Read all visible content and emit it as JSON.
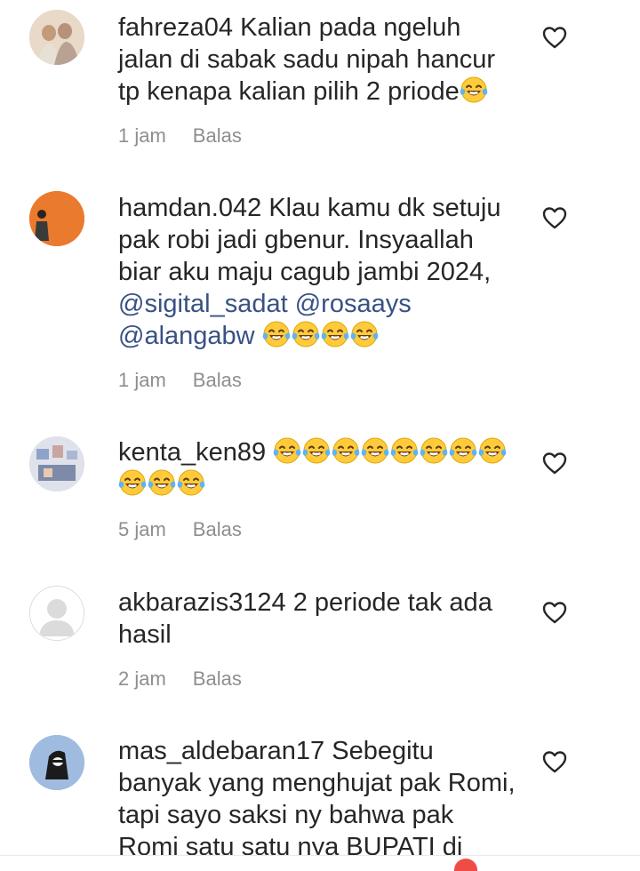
{
  "comments": [
    {
      "username": "fahreza04",
      "text": "Kalian pada ngeluh jalan di sabak sadu nipah hancur tp kenapa kalian pilih 2 priode",
      "emojis_after": 1,
      "time": "1 jam",
      "reply_label": "Balas",
      "avatar_colors": [
        "#c9a98b",
        "#e8d8c8"
      ]
    },
    {
      "username": "hamdan.042",
      "text": "Klau kamu dk setuju pak robi jadi gbenur. Insyaallah biar aku maju cagub jambi 2024,",
      "mentions": [
        "@sigital_sadat",
        "@rosaays",
        "@alangabw"
      ],
      "emojis_after": 4,
      "time": "1 jam",
      "reply_label": "Balas",
      "avatar_colors": [
        "#e8762c",
        "#2a2a2a"
      ]
    },
    {
      "username": "kenta_ken89",
      "text": "",
      "emojis_after": 11,
      "time": "5 jam",
      "reply_label": "Balas",
      "avatar_colors": [
        "#b8c4d8",
        "#e8e8f0"
      ]
    },
    {
      "username": "akbarazis3124",
      "text": "2 periode tak ada hasil",
      "emojis_after": 0,
      "time": "2 jam",
      "reply_label": "Balas",
      "avatar_colors": [
        "#dbdbdb",
        "#ffffff"
      ]
    },
    {
      "username": "mas_aldebaran17",
      "text": "Sebegitu banyak yang menghujat pak Romi, tapi sayo saksi ny bahwa pak Romi satu satu nya BUPATI di",
      "emojis_after": 0,
      "avatar_colors": [
        "#9ab8dd",
        "#1a1a1a"
      ]
    }
  ],
  "icons": {
    "like": "heart-outline-icon",
    "emoji": "laughing-tears-emoji"
  },
  "colors": {
    "text": "#262626",
    "meta": "#8e8e8e",
    "mention": "#385185",
    "notification": "#ef4c46"
  }
}
